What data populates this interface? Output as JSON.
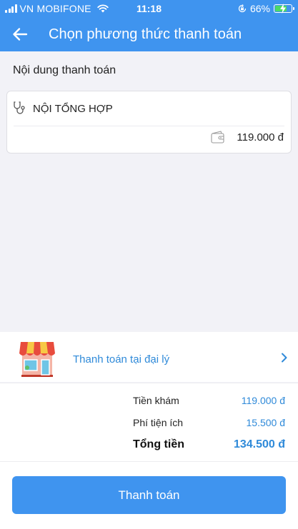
{
  "status_bar": {
    "carrier": "VN MOBIFONE",
    "time": "11:18",
    "battery_percent": "66%",
    "battery_level": 0.66,
    "icons": [
      "signal-icon",
      "wifi-icon",
      "rotation-lock-icon",
      "battery-icon"
    ]
  },
  "header": {
    "back_icon": "back-arrow-icon",
    "title": "Chọn phương thức thanh toán"
  },
  "content": {
    "section_title": "Nội dung thanh toán",
    "service": {
      "icon": "stethoscope-icon",
      "name": "NỘI TỔNG HỢP",
      "price_icon": "wallet-icon",
      "price": "119.000 đ"
    }
  },
  "payment_method": {
    "icon": "store-icon",
    "label": "Thanh toán tại đại lý",
    "chevron_icon": "chevron-right-icon"
  },
  "summary": {
    "exam_fee_label": "Tiền khám",
    "exam_fee_value": "119.000 đ",
    "utility_fee_label": "Phí tiện ích",
    "utility_fee_value": "15.500 đ",
    "total_label": "Tổng tiền",
    "total_value": "134.500 đ"
  },
  "footer": {
    "pay_button": "Thanh toán"
  },
  "colors": {
    "primary": "#3f94ef",
    "link": "#2f8ad9",
    "background": "#f2f2f7",
    "battery": "#4cd964"
  }
}
